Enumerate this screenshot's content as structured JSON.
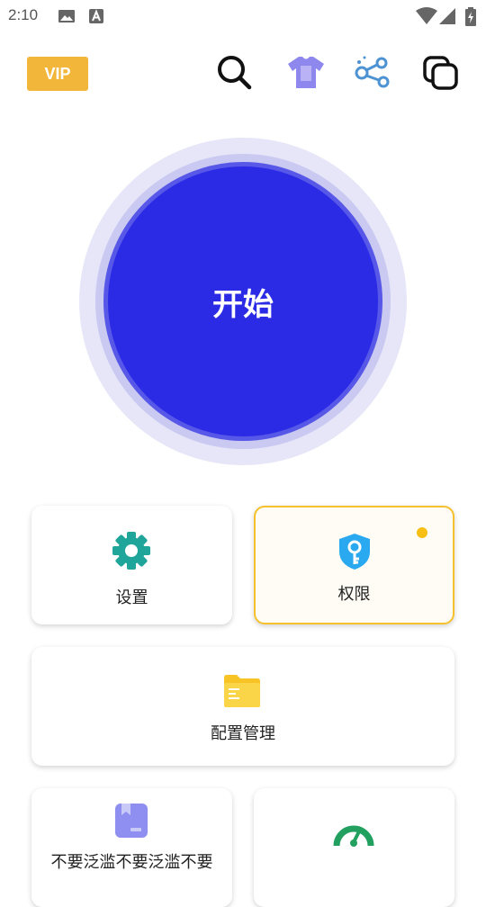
{
  "status_bar": {
    "time": "2:10"
  },
  "top_bar": {
    "vip_label": "VIP",
    "icons": [
      "search-icon",
      "tshirt-theme-icon",
      "share-icon",
      "copy-windows-icon"
    ]
  },
  "start_button": {
    "label": "开始"
  },
  "cards": {
    "settings": {
      "label": "设置",
      "icon": "gear-icon",
      "color": "#1fa59a"
    },
    "permissions": {
      "label": "权限",
      "icon": "shield-key-icon",
      "color": "#2ba9f0",
      "has_badge": true
    },
    "config_management": {
      "label": "配置管理",
      "icon": "folder-icon",
      "color": "#f7c325"
    },
    "card4": {
      "label": "不要泛滥不要泛滥不要",
      "icon": "bookmark-book-icon",
      "color": "#8e8ff0"
    },
    "card5": {
      "label": "",
      "icon": "speedometer-icon",
      "color": "#22a060"
    }
  },
  "colors": {
    "primary": "#2b2be6",
    "vip": "#f2b63a",
    "active_border": "#f5c12e"
  }
}
